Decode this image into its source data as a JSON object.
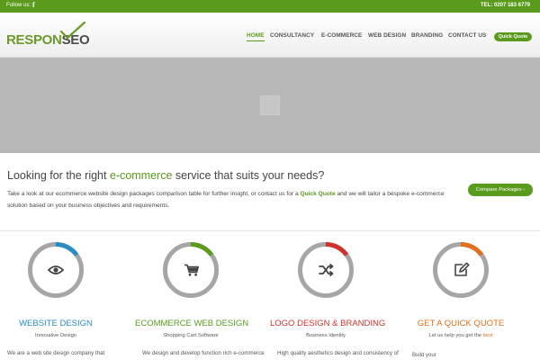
{
  "topbar": {
    "follow_label": "Follow us:",
    "facebook_glyph": "f",
    "phone": "TEL: 0207 183 6779"
  },
  "logo": {
    "part1": "RESPON",
    "part2": "SEO"
  },
  "nav": {
    "items": [
      {
        "label": "HOME",
        "active": true
      },
      {
        "label": "CONSULTANCY"
      },
      {
        "label": "E-COMMERCE"
      },
      {
        "label": "WEB DESIGN"
      },
      {
        "label": "BRANDING"
      },
      {
        "label": "CONTACT US"
      }
    ],
    "quote_button": "Quick Quote"
  },
  "intro": {
    "title_before": "Looking for the right ",
    "title_highlight": "e-commerce",
    "title_after": " service that suits your needs?",
    "text_before": "Take a look at our ecommerce website design packages comparison table for further insight, or contact us for a ",
    "text_highlight": "Quick Quote",
    "text_after": " and we will tailor a bespoke e-commerce solution based on your business objectives and requirements.",
    "compare_button": "Compare Packages ›"
  },
  "services": [
    {
      "icon": "eye-icon",
      "title": "WEBSITE DESIGN",
      "subtitle": "Innovative Design",
      "body": "We  are  a  web  site  design  company  that",
      "color": "#2a8cc4"
    },
    {
      "icon": "cart-icon",
      "title": "ECOMMERCE WEB DESIGN",
      "subtitle": "Shopping Cart Software",
      "body": "We design and develop function rich e-commerce",
      "color": "#5a9a1c"
    },
    {
      "icon": "shuffle-icon",
      "title": "LOGO DESIGN & BRANDING",
      "subtitle": "Business Identity",
      "body": "High quality aesthetics design and consistency of",
      "color": "#d0332b"
    },
    {
      "icon": "edit-icon",
      "title": "GET A QUICK QUOTE",
      "subtitle_before": "Let us help you get the ",
      "subtitle_highlight": "best",
      "body": "",
      "color": "#e0701e"
    }
  ],
  "extra": {
    "text": "Build your"
  },
  "colors": {
    "brand_green": "#5a9a1c",
    "ring_grey": "#a6a6a6",
    "hero_grey": "#b8b8b8"
  }
}
